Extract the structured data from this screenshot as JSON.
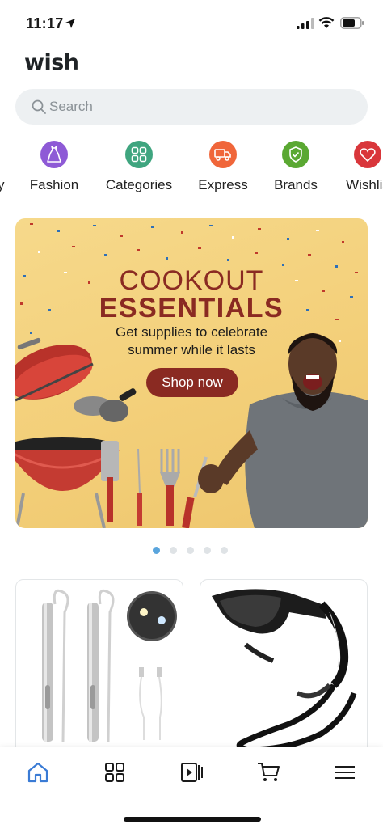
{
  "status_bar": {
    "time": "11:17"
  },
  "header": {
    "logo": "wish"
  },
  "search": {
    "placeholder": "Search"
  },
  "categories": [
    {
      "partial_label": "y"
    },
    {
      "label": "Fashion",
      "icon": "dress-icon",
      "color": "#8e5ad6"
    },
    {
      "label": "Categories",
      "icon": "grid-icon",
      "color": "#3fa57f"
    },
    {
      "label": "Express",
      "icon": "truck-icon",
      "color": "#f0663a"
    },
    {
      "label": "Brands",
      "icon": "shield-check-icon",
      "color": "#5aa832"
    },
    {
      "label": "Wishlis",
      "icon": "heart-icon",
      "color": "#d9363b"
    }
  ],
  "banner": {
    "title_line1": "COOKOUT",
    "title_line2": "ESSENTIALS",
    "subtitle_line1": "Get supplies to celebrate",
    "subtitle_line2": "summer while it lasts",
    "button": "Shop now",
    "accent_color": "#8a2a22"
  },
  "carousel": {
    "count": 5,
    "active": 0
  },
  "products": [
    {
      "name": "penlight-product",
      "icon": "penlight-image"
    },
    {
      "name": "sunglasses-product",
      "icon": "sunglasses-image"
    }
  ],
  "bottom_nav": [
    {
      "name": "home",
      "icon": "home-icon",
      "active": true
    },
    {
      "name": "categories",
      "icon": "grid-icon"
    },
    {
      "name": "videos",
      "icon": "video-icon"
    },
    {
      "name": "cart",
      "icon": "cart-icon"
    },
    {
      "name": "menu",
      "icon": "menu-icon"
    }
  ],
  "colors": {
    "active_nav": "#3a7bd5",
    "search_bg": "#edf0f2"
  }
}
